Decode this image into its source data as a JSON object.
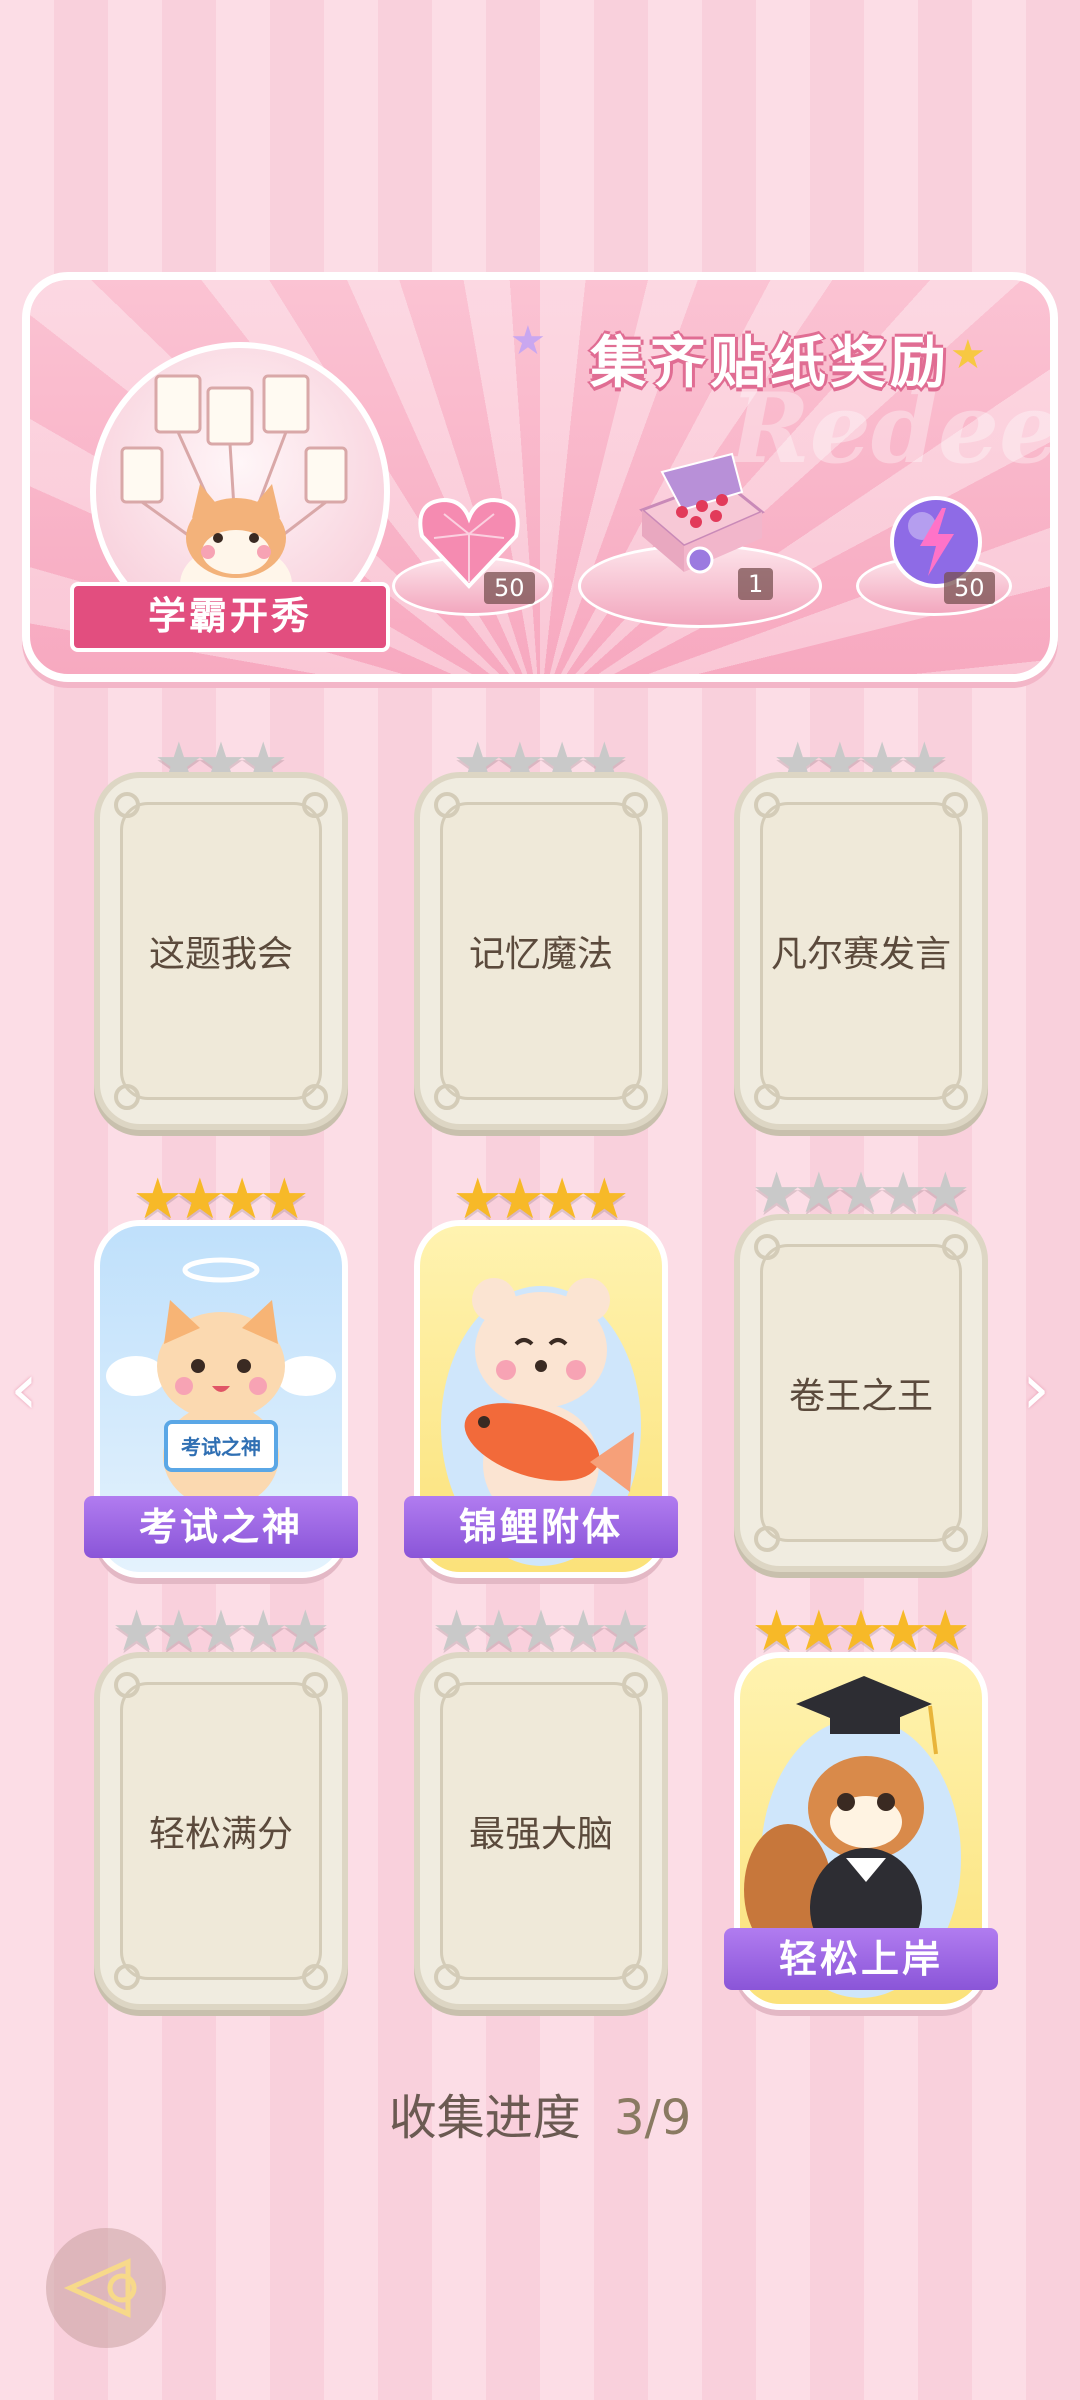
{
  "banner": {
    "title": "集齐贴纸奖励",
    "decor_text": "Redeem",
    "badge_label": "学霸开秀",
    "rewards": [
      {
        "name": "pink-diamond-heart-icon",
        "qty": "50"
      },
      {
        "name": "gift-box-icon",
        "qty": "1"
      },
      {
        "name": "lightning-orb-icon",
        "qty": "50"
      }
    ]
  },
  "stickers": [
    {
      "label": "这题我会",
      "stars": 3,
      "unlocked": false
    },
    {
      "label": "记忆魔法",
      "stars": 4,
      "unlocked": false
    },
    {
      "label": "凡尔赛发言",
      "stars": 4,
      "unlocked": false
    },
    {
      "label": "考试之神",
      "stars": 4,
      "unlocked": true,
      "sign": "考试之神"
    },
    {
      "label": "锦鲤附体",
      "stars": 4,
      "unlocked": true
    },
    {
      "label": "卷王之王",
      "stars": 5,
      "unlocked": false
    },
    {
      "label": "轻松满分",
      "stars": 5,
      "unlocked": false
    },
    {
      "label": "最强大脑",
      "stars": 5,
      "unlocked": false
    },
    {
      "label": "轻松上岸",
      "stars": 5,
      "unlocked": true
    }
  ],
  "progress": {
    "label": "收集进度",
    "value": "3/9"
  },
  "nav": {
    "prev": "‹",
    "next": "›"
  },
  "colors": {
    "gold_star": "#f7b928",
    "grey_star": "#c9c9c9",
    "ribbon": "#8a55d8",
    "accent": "#e24e7f"
  }
}
